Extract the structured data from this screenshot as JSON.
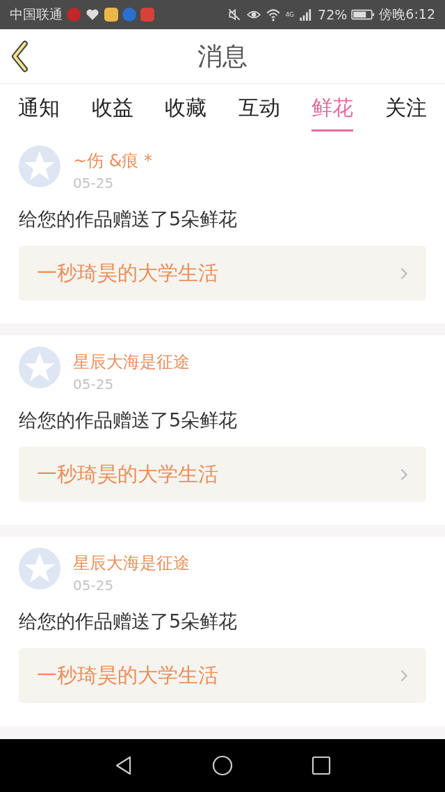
{
  "status_bar": {
    "carrier": "中国联通",
    "network": "4G",
    "battery": "72%",
    "time": "傍晚6:12"
  },
  "header": {
    "title": "消息"
  },
  "tabs": [
    {
      "label": "通知",
      "selected": false
    },
    {
      "label": "收益",
      "selected": false
    },
    {
      "label": "收藏",
      "selected": false
    },
    {
      "label": "互动",
      "selected": false
    },
    {
      "label": "鲜花",
      "selected": true
    },
    {
      "label": "关注",
      "selected": false
    }
  ],
  "messages": [
    {
      "user": "~伤 &痕 *",
      "date": "05-25",
      "text": "给您的作品赠送了5朵鲜花",
      "work": "一秒琦昊的大学生活"
    },
    {
      "user": "星辰大海是征途",
      "date": "05-25",
      "text": "给您的作品赠送了5朵鲜花",
      "work": "一秒琦昊的大学生活"
    },
    {
      "user": "星辰大海是征途",
      "date": "05-25",
      "text": "给您的作品赠送了5朵鲜花",
      "work": "一秒琦昊的大学生活"
    }
  ]
}
